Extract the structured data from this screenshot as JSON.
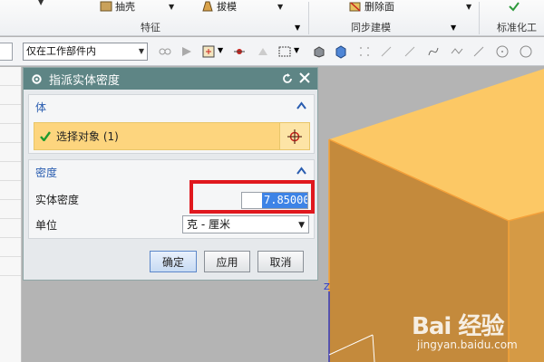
{
  "ribbon": {
    "extract_label": "抽壳",
    "draft_label": "拔模",
    "delete_face_label": "删除面",
    "groups": [
      "特征",
      "同步建模",
      "标准化工具"
    ]
  },
  "toolbar": {
    "selection_filter": "仅在工作部件内"
  },
  "dialog": {
    "title": "指派实体密度",
    "body_section": {
      "title": "体",
      "select_label": "选择对象 (1)"
    },
    "density_section": {
      "title": "密度",
      "density_label": "实体密度",
      "density_value": "7.85000",
      "unit_label": "单位",
      "unit_value": "克 - 厘米"
    },
    "buttons": {
      "ok": "确定",
      "apply": "应用",
      "cancel": "取消"
    }
  },
  "viewport": {
    "axis_label": "Z"
  },
  "watermark": {
    "logo_text": "Bai 经验",
    "url": "jingyan.baidu.com"
  },
  "colors": {
    "dialog_title_bg": "#5e8585",
    "section_title": "#2a5db0",
    "selection_highlight": "#fdd57e",
    "annotation_red": "#e0181e",
    "solid_face_top": "#fcc865",
    "solid_face_side": "#c48a3c",
    "viewport_bg": "#b4b4b4"
  }
}
